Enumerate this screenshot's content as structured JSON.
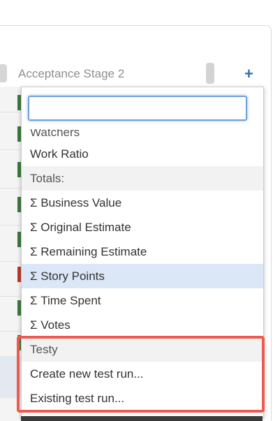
{
  "column": {
    "title": "Acceptance Stage 2",
    "add_symbol": "+"
  },
  "dropdown": {
    "search_value": "",
    "items": [
      {
        "label": "Watchers",
        "kind": "cut"
      },
      {
        "label": "Work Ratio",
        "kind": "item"
      },
      {
        "label": "Totals:",
        "kind": "group"
      },
      {
        "label": "Σ Business Value",
        "kind": "item"
      },
      {
        "label": "Σ Original Estimate",
        "kind": "item"
      },
      {
        "label": "Σ Remaining Estimate",
        "kind": "item"
      },
      {
        "label": "Σ Story Points",
        "kind": "selected"
      },
      {
        "label": "Σ Time Spent",
        "kind": "item"
      },
      {
        "label": "Σ Votes",
        "kind": "item"
      },
      {
        "label": "Testy",
        "kind": "group"
      },
      {
        "label": "Create new test run...",
        "kind": "item"
      },
      {
        "label": "Existing test run...",
        "kind": "item"
      }
    ]
  },
  "colors": {
    "accent": "#3572b0",
    "selected_row": "#dbe7f7",
    "highlight": "#ef5a50",
    "marker_green": "#3c7a3c",
    "marker_red": "#c0392b"
  },
  "icons": {
    "add": "plus-icon"
  }
}
